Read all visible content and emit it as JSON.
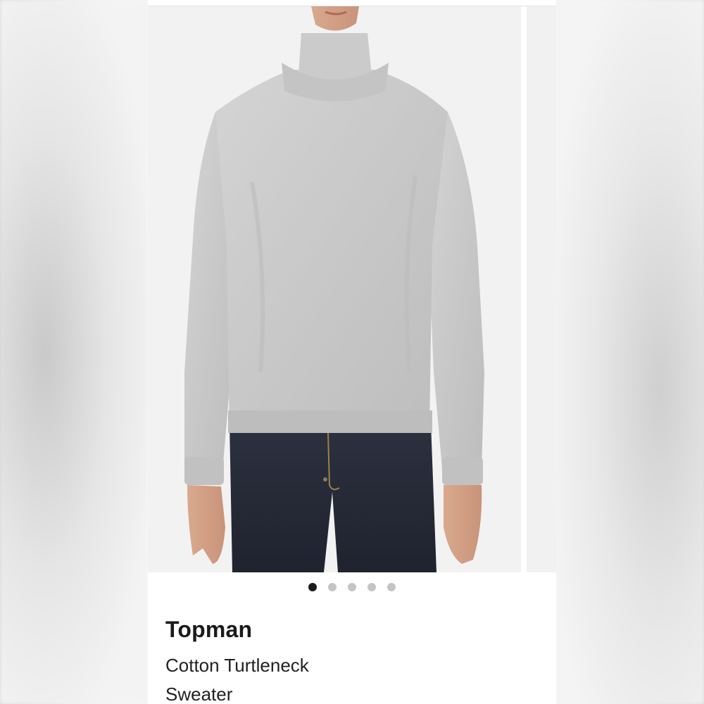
{
  "product": {
    "brand": "Topman",
    "name": "Cotton Turtleneck Sweater",
    "image_subject": "Man wearing grey turtleneck sweater and dark jeans"
  },
  "carousel": {
    "total": 5,
    "active_index": 0
  },
  "colors": {
    "sweater": "#c9c9c9",
    "jeans": "#262b36",
    "dot_active": "#1a1a1a",
    "dot_inactive": "#c4c4c4"
  }
}
